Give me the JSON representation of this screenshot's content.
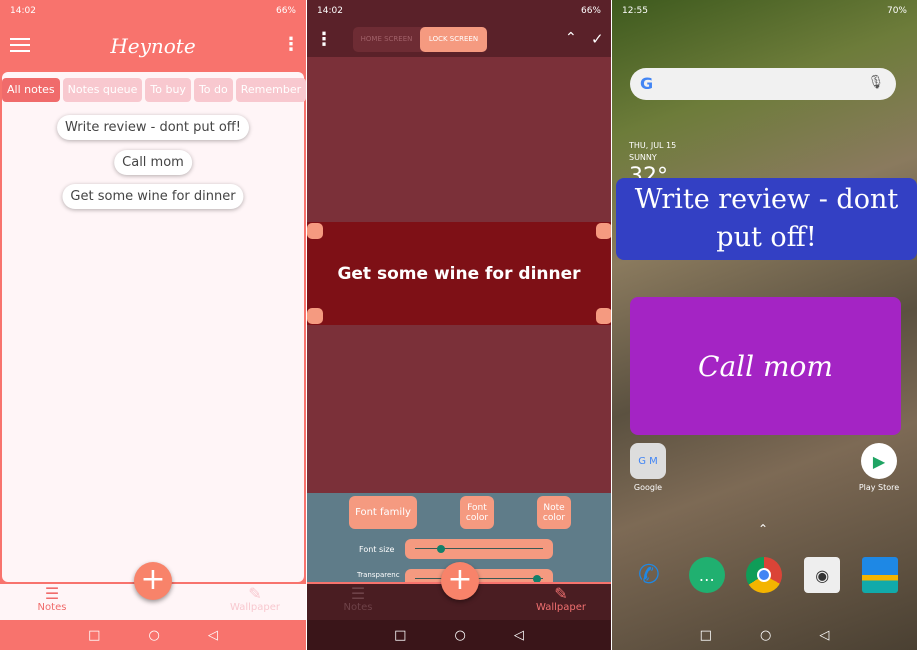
{
  "screen1": {
    "status": {
      "time": "14:02",
      "battery": "66%"
    },
    "app_title": "Heynote",
    "tabs": [
      {
        "label": "All notes",
        "active": true
      },
      {
        "label": "Notes queue"
      },
      {
        "label": "To buy"
      },
      {
        "label": "To do"
      },
      {
        "label": "Remember"
      }
    ],
    "notes": [
      "Write review - dont put off!",
      "Call mom",
      "Get some wine for dinner"
    ],
    "nav": {
      "notes": "Notes",
      "wallpaper": "Wallpaper"
    },
    "fab": "+"
  },
  "screen2": {
    "status": {
      "time": "14:02",
      "battery": "66%"
    },
    "toggle": {
      "home": "HOME SCREEN",
      "lock": "LOCK SCREEN",
      "selected": "lock"
    },
    "preview_note": "Get some wine for dinner",
    "controls": {
      "font_family": "Font family",
      "font_color": "Font color",
      "note_color": "Note color",
      "font_size": "Font size",
      "transparency": "Transparenc"
    },
    "font_size_level": 0.2,
    "transparency_level": 0.95,
    "nav": {
      "notes": "Notes",
      "wallpaper": "Wallpaper"
    },
    "fab": "+"
  },
  "screen3": {
    "status": {
      "time": "12:55",
      "battery": "70%"
    },
    "search_logo": "G",
    "date": "THU, JUL 15",
    "weather": "SUNNY",
    "temp": "32°",
    "widget_notes": [
      {
        "text": "Write review - dont put off!",
        "color": "#3340c4"
      },
      {
        "text": "Call mom",
        "color": "#a424c4"
      }
    ],
    "apps": [
      {
        "label": "Google"
      },
      {
        "label": "Play Store"
      }
    ],
    "dock": [
      "Phone",
      "Messages",
      "Chrome",
      "Camera",
      "Wallpapers"
    ]
  },
  "colors": {
    "accent": "#f8736d",
    "chip": "#f59a80"
  }
}
